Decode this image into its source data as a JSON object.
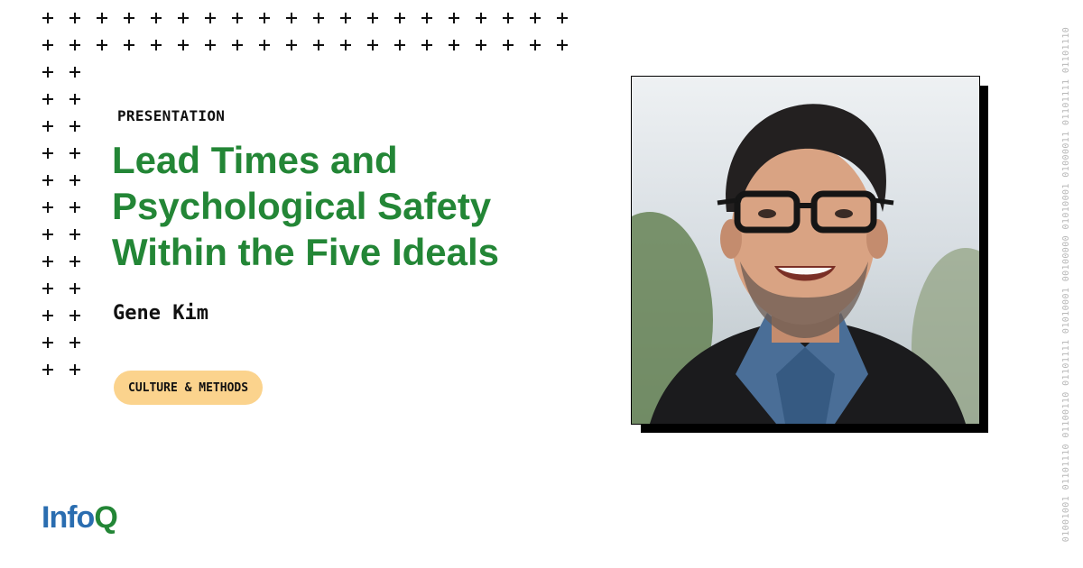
{
  "kicker": "PRESENTATION",
  "title_lines": [
    "Lead Times and",
    "Psychological Safety",
    "Within the Five Ideals"
  ],
  "speaker": "Gene Kim",
  "tag": "CULTURE & METHODS",
  "logo": {
    "text": "InfoQ"
  },
  "binary_text": "01001001 01101110 01100110 01101111 01010001 00100000 01010001 01000011 01101111 01101110",
  "photo_alt": "speaker-photo",
  "colors": {
    "title": "#238636",
    "tag_bg": "#fbd38d",
    "logo_blue": "#2a6db0",
    "logo_green": "#238636"
  },
  "icons": {
    "grid": "plus-icon"
  }
}
